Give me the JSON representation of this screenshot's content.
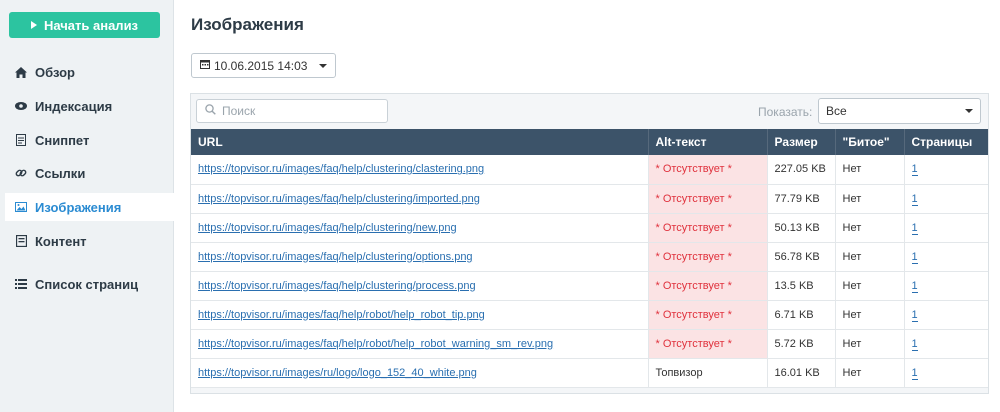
{
  "sidebar": {
    "start_button": "Начать анализ",
    "items": [
      {
        "label": "Обзор",
        "icon": "home-icon"
      },
      {
        "label": "Индексация",
        "icon": "eye-icon"
      },
      {
        "label": "Сниппет",
        "icon": "document-icon"
      },
      {
        "label": "Ссылки",
        "icon": "link-icon"
      },
      {
        "label": "Изображения",
        "icon": "image-icon",
        "active": true
      },
      {
        "label": "Контент",
        "icon": "content-icon"
      },
      {
        "label": "Список страниц",
        "icon": "list-icon"
      }
    ]
  },
  "main": {
    "title": "Изображения",
    "date": "10.06.2015 14:03",
    "search_placeholder": "Поиск",
    "show_label": "Показать:",
    "show_value": "Все",
    "columns": [
      "URL",
      "Alt-текст",
      "Размер",
      "\"Битое\"",
      "Страницы"
    ],
    "rows": [
      {
        "url": "https://topvisor.ru/images/faq/help/clustering/clastering.png",
        "alt": "* Отсутствует *",
        "size": "227.05 KB",
        "broken": "Нет",
        "pages": "1"
      },
      {
        "url": "https://topvisor.ru/images/faq/help/clustering/imported.png",
        "alt": "* Отсутствует *",
        "size": "77.79 KB",
        "broken": "Нет",
        "pages": "1"
      },
      {
        "url": "https://topvisor.ru/images/faq/help/clustering/new.png",
        "alt": "* Отсутствует *",
        "size": "50.13 KB",
        "broken": "Нет",
        "pages": "1"
      },
      {
        "url": "https://topvisor.ru/images/faq/help/clustering/options.png",
        "alt": "* Отсутствует *",
        "size": "56.78 KB",
        "broken": "Нет",
        "pages": "1"
      },
      {
        "url": "https://topvisor.ru/images/faq/help/clustering/process.png",
        "alt": "* Отсутствует *",
        "size": "13.5 KB",
        "broken": "Нет",
        "pages": "1"
      },
      {
        "url": "https://topvisor.ru/images/faq/help/robot/help_robot_tip.png",
        "alt": "* Отсутствует *",
        "size": "6.71 KB",
        "broken": "Нет",
        "pages": "1"
      },
      {
        "url": "https://topvisor.ru/images/faq/help/robot/help_robot_warning_sm_rev.png",
        "alt": "* Отсутствует *",
        "size": "5.72 KB",
        "broken": "Нет",
        "pages": "1"
      },
      {
        "url": "https://topvisor.ru/images/ru/logo/logo_152_40_white.png",
        "alt": "Топвизор",
        "size": "16.01 KB",
        "broken": "Нет",
        "pages": "1"
      }
    ]
  },
  "colors": {
    "accent": "#2cc4a0",
    "header": "#3c5369",
    "missing_bg": "#fbe3e4",
    "missing_text": "#e0323d",
    "link": "#2a6fb0"
  }
}
